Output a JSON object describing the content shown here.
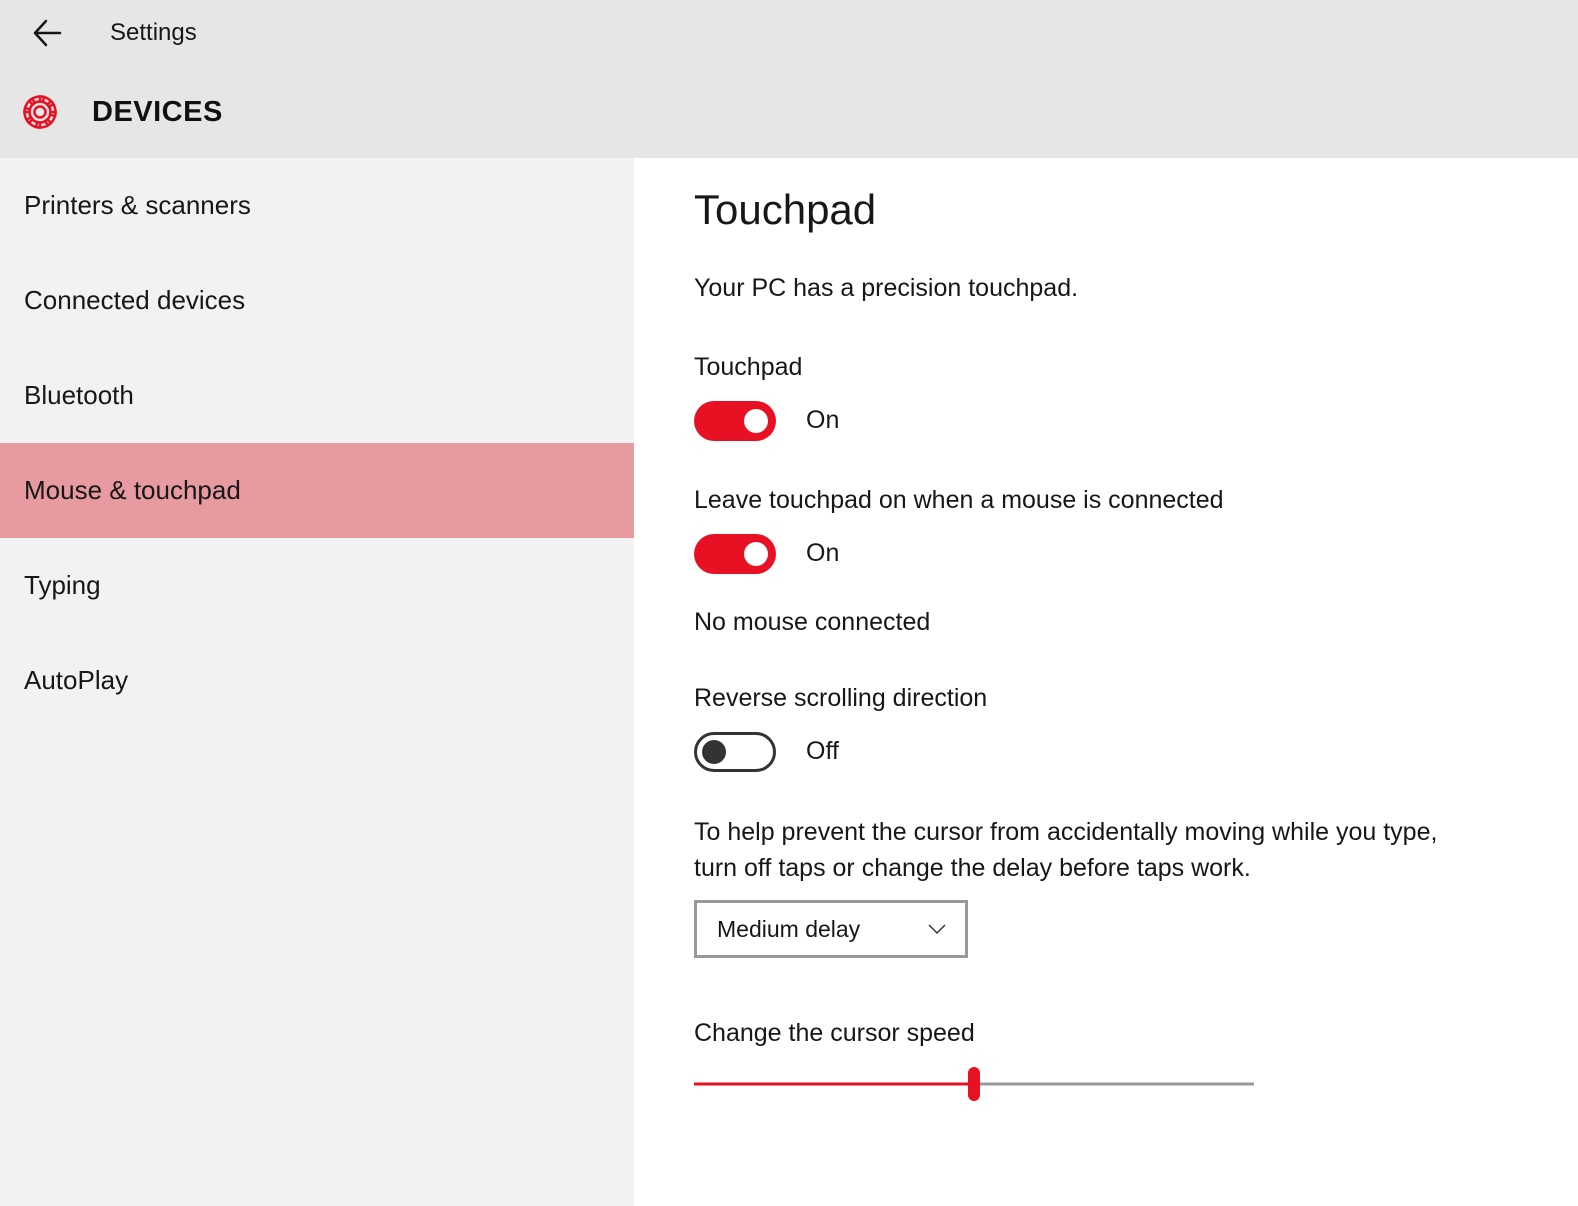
{
  "header": {
    "app_title": "Settings",
    "category": "DEVICES"
  },
  "sidebar": {
    "items": [
      {
        "label": "Printers & scanners",
        "selected": false
      },
      {
        "label": "Connected devices",
        "selected": false
      },
      {
        "label": "Bluetooth",
        "selected": false
      },
      {
        "label": "Mouse & touchpad",
        "selected": true
      },
      {
        "label": "Typing",
        "selected": false
      },
      {
        "label": "AutoPlay",
        "selected": false
      }
    ]
  },
  "main": {
    "page_title": "Touchpad",
    "subtitle": "Your PC has a precision touchpad.",
    "toggles": [
      {
        "label": "Touchpad",
        "on": true,
        "status": "On"
      },
      {
        "label": "Leave touchpad on when a mouse is connected",
        "on": true,
        "status": "On"
      }
    ],
    "mouse_status": "No mouse connected",
    "reverse_scroll": {
      "label": "Reverse scrolling direction",
      "on": false,
      "status": "Off"
    },
    "tap_delay": {
      "help": "To help prevent the cursor from accidentally moving while you type, turn off taps or change the delay before taps work.",
      "selected": "Medium delay"
    },
    "cursor_speed": {
      "label": "Change the cursor speed",
      "value_percent": 50
    }
  },
  "colors": {
    "accent": "#e81123",
    "sidebar_selected": "#e79ba1"
  }
}
